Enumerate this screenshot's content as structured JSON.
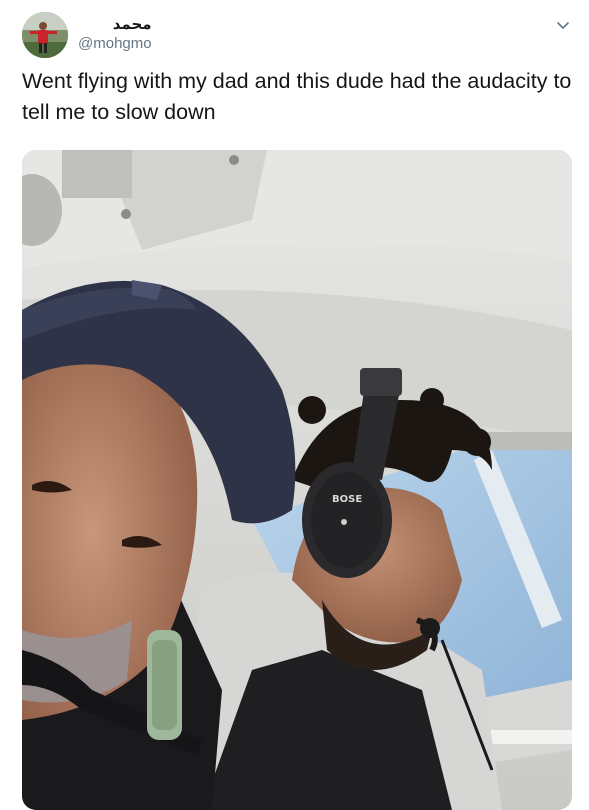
{
  "tweet": {
    "display_name": "محمد",
    "handle": "@mohgmo",
    "text": "Went flying with my dad and this dude had the audacity to tell me to slow down",
    "menu_icon": "chevron-down-icon"
  },
  "photo": {
    "headset_brand": "BOSE",
    "colors": {
      "ceiling": "#dcdcda",
      "sky": "#a8c8e4",
      "cap": "#2e3347",
      "headset": "#2a2a2c",
      "hoodie": "#d4d4d2",
      "vest": "#1f1f22",
      "skin": "#b98468",
      "hair": "#1c1612"
    }
  }
}
